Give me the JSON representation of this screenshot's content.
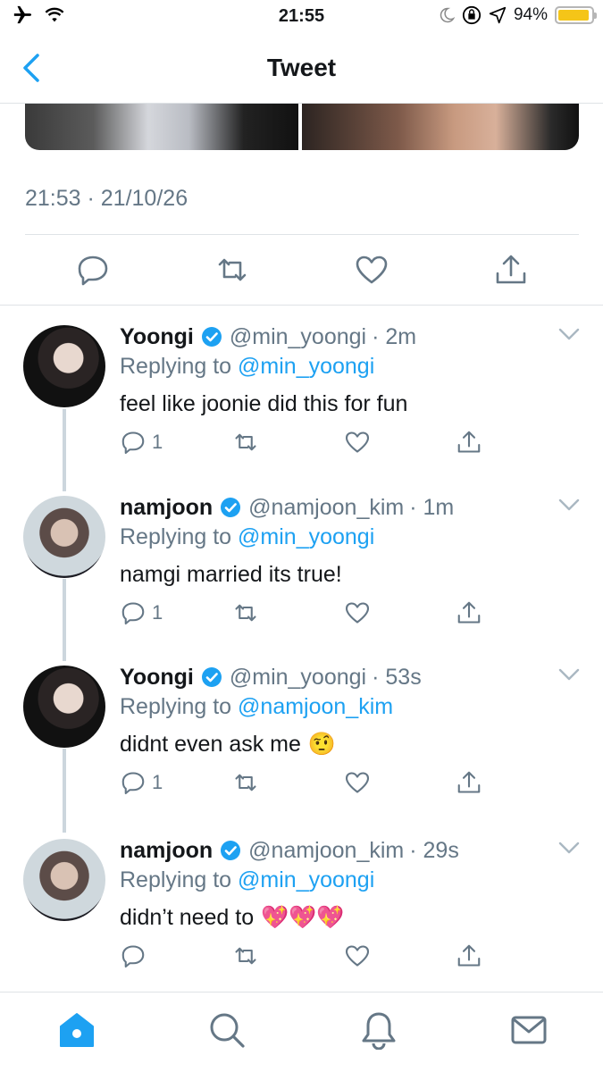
{
  "status_bar": {
    "time": "21:55",
    "battery": "94%",
    "battery_level": 0.94,
    "icons": [
      "airplane-icon",
      "wifi-icon",
      "moon-icon",
      "orientation-lock-icon",
      "location-icon",
      "battery-icon"
    ]
  },
  "header": {
    "title": "Tweet",
    "back_icon": "chevron-left-icon"
  },
  "tweet": {
    "timestamp": "21:53 · 21/10/26"
  },
  "colors": {
    "accent": "#1da1f2",
    "secondary_text": "#657786",
    "primary_text": "#14171a",
    "divider": "#dfe3e6"
  },
  "replies": [
    {
      "name": "Yoongi",
      "handle": "@min_yoongi",
      "time": "· 2m",
      "replying_prefix": "Replying to",
      "replying_to": "@min_yoongi",
      "text": "feel like joonie did this for fun",
      "emoji": "",
      "reply_count": "1"
    },
    {
      "name": "namjoon",
      "handle": "@namjoon_kim",
      "time": "· 1m",
      "replying_prefix": "Replying to",
      "replying_to": "@min_yoongi",
      "text": "namgi married its true!",
      "emoji": "",
      "reply_count": "1"
    },
    {
      "name": "Yoongi",
      "handle": "@min_yoongi",
      "time": "· 53s",
      "replying_prefix": "Replying to",
      "replying_to": "@namjoon_kim",
      "text": "didnt even ask me",
      "emoji": "🤨",
      "reply_count": "1"
    },
    {
      "name": "namjoon",
      "handle": "@namjoon_kim",
      "time": "· 29s",
      "replying_prefix": "Replying to",
      "replying_to": "@min_yoongi",
      "text": "didn’t need to",
      "emoji": "💖💖💖",
      "reply_count": ""
    }
  ],
  "tab_bar": {
    "tabs": [
      "home-icon",
      "search-icon",
      "notifications-icon",
      "messages-icon"
    ],
    "active": "home-icon"
  }
}
